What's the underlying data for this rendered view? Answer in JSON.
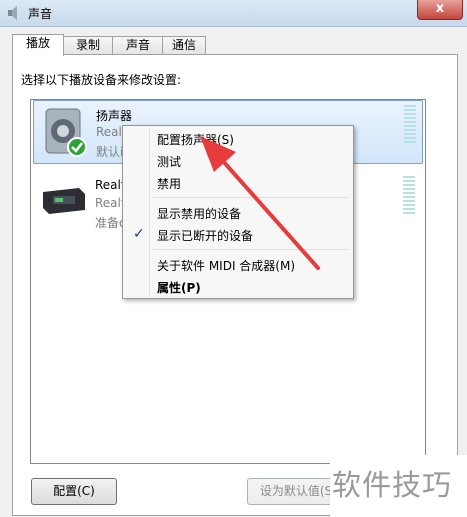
{
  "window": {
    "title": "声音",
    "close_label": "x"
  },
  "tabs": [
    {
      "label": "播放"
    },
    {
      "label": "录制"
    },
    {
      "label": "声音"
    },
    {
      "label": "通信"
    }
  ],
  "instruction": "选择以下播放设备来修改设置:",
  "devices": [
    {
      "name": "扬声器",
      "line1": "Realt",
      "line2": "默认i"
    },
    {
      "name": "Realt",
      "line1": "Realt",
      "line2": "准备d"
    }
  ],
  "context_menu": {
    "items": [
      {
        "label": "配置扬声器(S)"
      },
      {
        "label": "测试"
      },
      {
        "label": "禁用"
      },
      {
        "label": "显示禁用的设备"
      },
      {
        "label": "显示已断开的设备"
      },
      {
        "label": "关于软件 MIDI 合成器(M)"
      },
      {
        "label": "属性(P)"
      }
    ]
  },
  "buttons": {
    "configure": "配置(C)",
    "set_default": "设为默认值(S"
  },
  "watermark": "软件技巧",
  "colors": {
    "arrow": "#e83b3b",
    "selection": "#d2e6fb",
    "check": "#1c3a8a"
  }
}
